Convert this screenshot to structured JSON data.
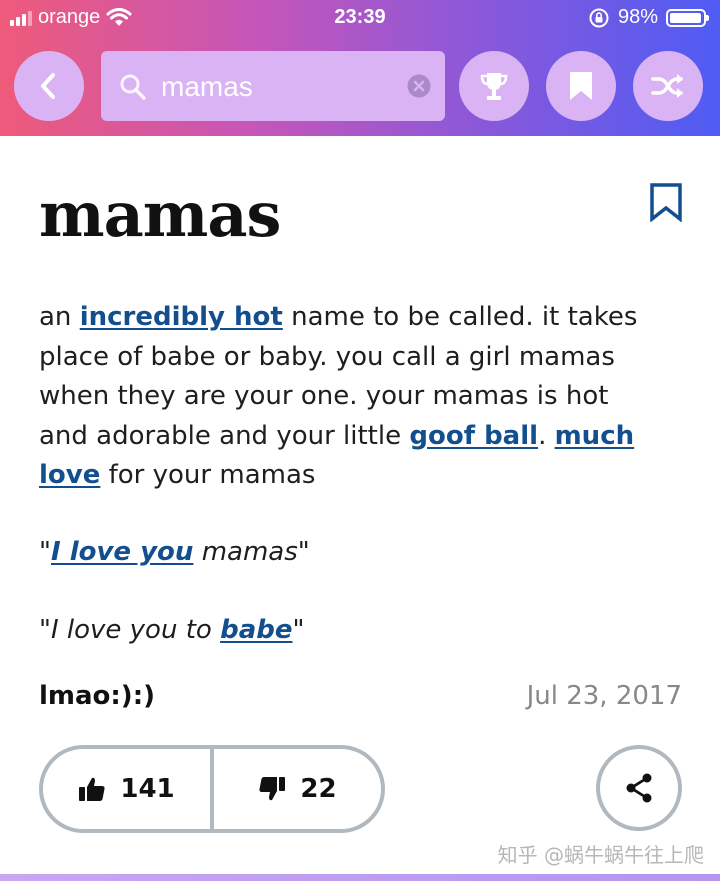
{
  "status_bar": {
    "carrier": "orange",
    "time": "23:39",
    "battery": "98%"
  },
  "header": {
    "search_value": "mamas",
    "buttons": [
      "back",
      "trophy",
      "bookmark",
      "shuffle"
    ]
  },
  "definition": {
    "word": "mamas",
    "meaning": {
      "t1": "an ",
      "link1": "incredibly hot",
      "t2": " name to be called. it takes place of babe or baby. you call a girl mamas when they are your one. your mamas is hot and adorable and your little ",
      "link2": "goof ball",
      "t3": ". ",
      "link3": "much love",
      "t4": " for your mamas"
    },
    "example1": {
      "q_open": "\"",
      "link": "I love you",
      "rest": " mamas\""
    },
    "example2": {
      "text": "\"I love you to ",
      "link": "babe",
      "q_close": "\""
    },
    "author": "lmao:):)",
    "date": "Jul 23, 2017",
    "upvotes": "141",
    "downvotes": "22"
  },
  "watermark": "知乎 @蜗牛蜗牛往上爬",
  "colors": {
    "header_gradient_start": "#ee5a7a",
    "header_gradient_end": "#4f5cf4",
    "button_bg": "#d9b3f3",
    "link": "#134f8f",
    "border": "#b0b8c0",
    "date": "#888888"
  }
}
